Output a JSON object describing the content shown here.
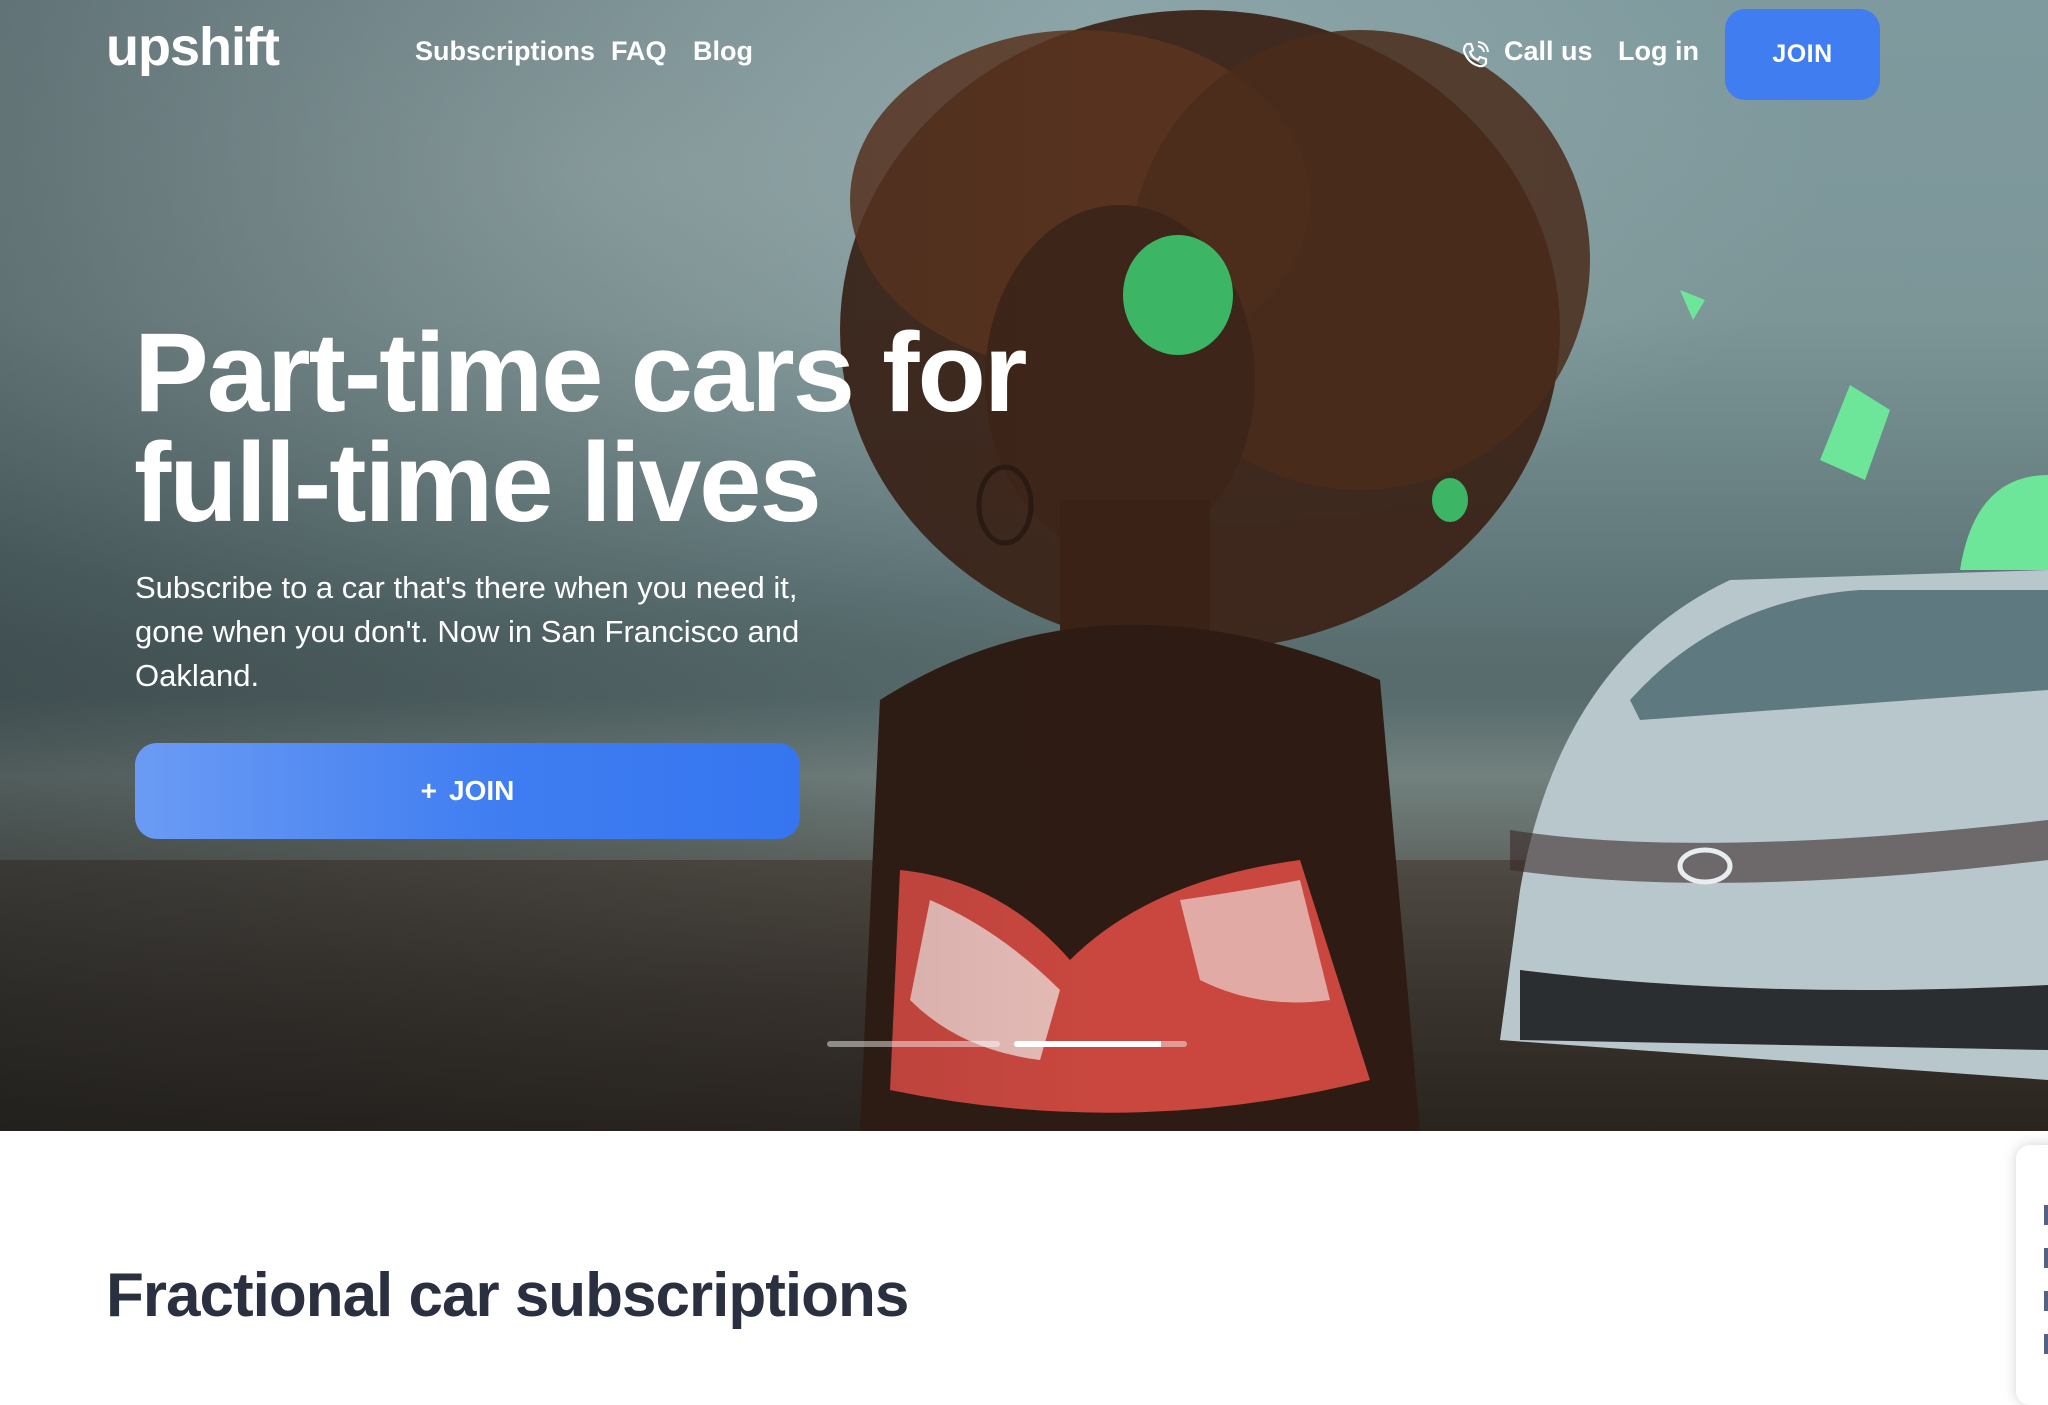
{
  "header": {
    "logo": "upshift",
    "nav": [
      "Subscriptions",
      "FAQ",
      "Blog"
    ],
    "call_label": "Call us",
    "login_label": "Log in",
    "join_label": "JOIN"
  },
  "hero": {
    "headline_line1": "Part-time cars for",
    "headline_line2": "full-time lives",
    "subcopy": "Subscribe to a car that's there when you need it, gone when you don't. Now in San Francisco and Oakland.",
    "cta_plus": "+",
    "cta_label": "JOIN",
    "carousel": {
      "slides": 2,
      "active_index": 1
    }
  },
  "section": {
    "title": "Fractional car subscriptions"
  },
  "icons": [
    "phone-icon",
    "plus-icon"
  ],
  "colors": {
    "accent": "#3f7df1",
    "text_dark": "#2b3040",
    "mint": "#6ee69a"
  }
}
